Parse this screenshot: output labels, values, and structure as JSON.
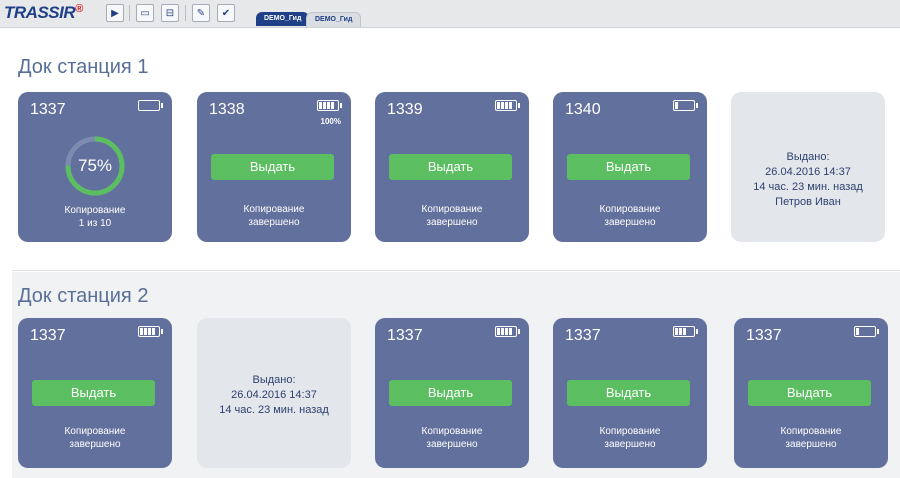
{
  "app": {
    "logo_text": "TRASSIR",
    "logo_mark": "®"
  },
  "toolbar": {
    "buttons": [
      {
        "icon": "play-icon",
        "glyph": "▶"
      },
      {
        "icon": "chat-icon",
        "glyph": "▭"
      },
      {
        "icon": "layout-icon",
        "glyph": "⊟"
      },
      {
        "icon": "wand-icon",
        "glyph": "✎"
      },
      {
        "icon": "edit-icon",
        "glyph": "✔"
      }
    ],
    "tabs": [
      {
        "label": "DEMO_Гид",
        "active": true
      },
      {
        "label": "DEMO_Гид",
        "active": false
      }
    ]
  },
  "stations": [
    {
      "title": "Док станция 1",
      "cards": [
        {
          "id": "1337",
          "state": "copying",
          "battery_bars": 0,
          "progress_percent": 75,
          "progress_label": "75%",
          "status_line1": "Копирование",
          "status_line2": "1 из 10"
        },
        {
          "id": "1338",
          "state": "ready",
          "battery_bars": 4,
          "battery_label": "100%",
          "button": "Выдать",
          "status_line1": "Копирование",
          "status_line2": "завершено"
        },
        {
          "id": "1339",
          "state": "ready",
          "battery_bars": 4,
          "button": "Выдать",
          "status_line1": "Копирование",
          "status_line2": "завершено"
        },
        {
          "id": "1340",
          "state": "ready",
          "battery_bars": 1,
          "button": "Выдать",
          "status_line1": "Копирование",
          "status_line2": "завершено"
        },
        {
          "state": "issued",
          "line1": "Выдано:",
          "line2": "26.04.2016 14:37",
          "line3": "14 час. 23 мин. назад",
          "line4": "Петров Иван"
        }
      ]
    },
    {
      "title": "Док станция 2",
      "cards": [
        {
          "id": "1337",
          "state": "ready",
          "battery_bars": 4,
          "button": "Выдать",
          "status_line1": "Копирование",
          "status_line2": "завершено"
        },
        {
          "state": "issued",
          "line1": "Выдано:",
          "line2": "26.04.2016 14:37",
          "line3": "14 час. 23 мин. назад"
        },
        {
          "id": "1337",
          "state": "ready",
          "battery_bars": 4,
          "button": "Выдать",
          "status_line1": "Копирование",
          "status_line2": "завершено"
        },
        {
          "id": "1337",
          "state": "ready",
          "battery_bars": 3,
          "button": "Выдать",
          "status_line1": "Копирование",
          "status_line2": "завершено"
        },
        {
          "id": "1337",
          "state": "ready",
          "battery_bars": 1,
          "button": "Выдать",
          "status_line1": "Копирование",
          "status_line2": "завершено"
        }
      ]
    }
  ],
  "colors": {
    "card": "#61709c",
    "card_idle": "#e3e6ea",
    "button": "#5bbf62",
    "progress": "#5bbf62",
    "title": "#5a6f97"
  }
}
